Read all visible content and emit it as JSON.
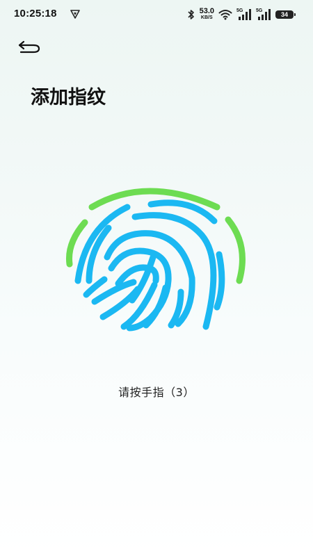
{
  "status_bar": {
    "time": "10:25:18",
    "network_speed": "53.0",
    "network_speed_unit": "KB/S",
    "signal1_label": "5G",
    "signal2_label": "5G",
    "battery_level": "34"
  },
  "header": {
    "back_icon": "back-arrow-icon"
  },
  "title": "添加指纹",
  "fingerprint": {
    "icon": "fingerprint-icon",
    "outer_color": "#6ddc52",
    "inner_color": "#1bb8f2"
  },
  "prompt": "请按手指（3）"
}
